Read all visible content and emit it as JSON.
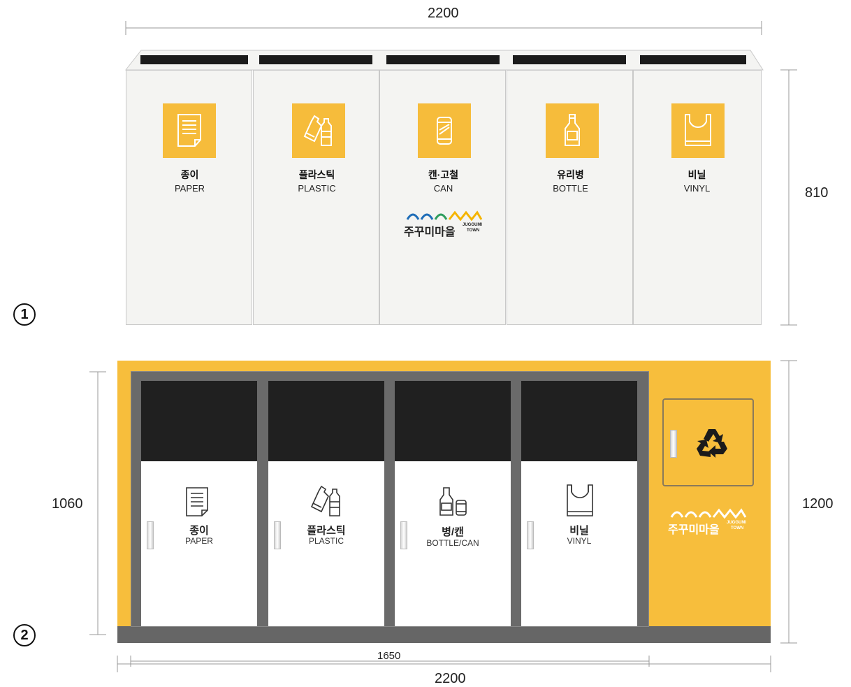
{
  "dimensions": {
    "bin1_width": "2200",
    "bin1_height": "810",
    "bin2_height_left": "1060",
    "bin2_height_right": "1200",
    "bin2_inner_width": "1650",
    "bin2_width": "2200"
  },
  "markers": {
    "first": "1",
    "second": "2"
  },
  "bin1": {
    "compartments": [
      {
        "ko": "종이",
        "en": "PAPER",
        "icon": "paper-icon"
      },
      {
        "ko": "플라스틱",
        "en": "PLASTIC",
        "icon": "plastic-bottles-icon"
      },
      {
        "ko": "캔·고철",
        "en": "CAN",
        "icon": "can-icon"
      },
      {
        "ko": "유리병",
        "en": "BOTTLE",
        "icon": "glass-bottle-icon"
      },
      {
        "ko": "비닐",
        "en": "VINYL",
        "icon": "plastic-bag-icon"
      }
    ],
    "logo": {
      "ko": "주꾸미마을",
      "en_top": "JUGGUMI",
      "en_bottom": "TOWN"
    }
  },
  "bin2": {
    "compartments": [
      {
        "ko": "종이",
        "en": "PAPER",
        "icon": "paper-icon"
      },
      {
        "ko": "플라스틱",
        "en": "PLASTIC",
        "icon": "plastic-bottles-icon"
      },
      {
        "ko": "병/캔",
        "en": "BOTTLE/CAN",
        "icon": "bottle-can-icon"
      },
      {
        "ko": "비닐",
        "en": "VINYL",
        "icon": "plastic-bag-icon"
      }
    ],
    "side_panel_icon": "recycle-icon",
    "logo": {
      "ko": "주꾸미마을",
      "en_top": "JUGGUMI",
      "en_bottom": "TOWN"
    }
  },
  "colors": {
    "accent_yellow": "#f6bc3b",
    "bin2_body": "#f7be3c",
    "slot_black": "#1b1b1b",
    "frame_gray": "#6a6a6a",
    "logo_blue": "#1f6db8",
    "logo_yellow": "#f5b400"
  }
}
